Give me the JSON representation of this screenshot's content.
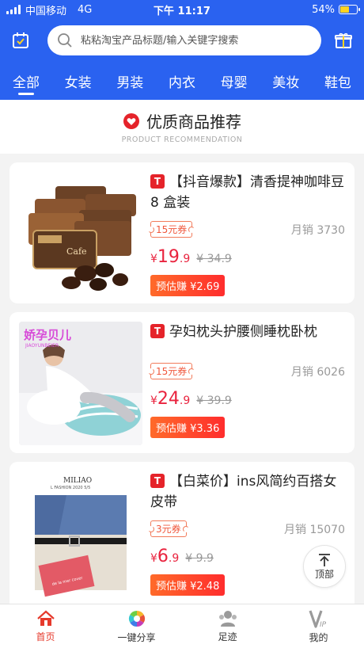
{
  "status_bar": {
    "carrier": "中国移动",
    "network": "4G",
    "time": "下午 11:17",
    "battery": "54%",
    "battery_fraction": 0.54
  },
  "search": {
    "placeholder": "粘粘淘宝产品标题/输入关键字搜索"
  },
  "icons": {
    "left": "calendar-check-icon",
    "search": "search-icon",
    "right": "gift-icon"
  },
  "tabs": [
    {
      "label": "全部",
      "active": true
    },
    {
      "label": "女装"
    },
    {
      "label": "男装"
    },
    {
      "label": "内衣"
    },
    {
      "label": "母婴"
    },
    {
      "label": "美妆"
    },
    {
      "label": "鞋包"
    }
  ],
  "recommend": {
    "title": "优质商品推荐",
    "subtitle": "PRODUCT RECOMMENDATION"
  },
  "products": [
    {
      "badge": "T",
      "title": "【抖音爆款】清香提神咖啡豆 8 盒装",
      "coupon": "15元券",
      "sales": "月销 3730",
      "price_currency": "¥",
      "price_int": "19",
      "price_dec": ".9",
      "original_price": "¥ 34.9",
      "earn": "预估赚 ¥2.69"
    },
    {
      "badge": "T",
      "title": "孕妇枕头护腰侧睡枕卧枕",
      "coupon": "15元券",
      "sales": "月销 6026",
      "price_currency": "¥",
      "price_int": "24",
      "price_dec": ".9",
      "original_price": "¥ 39.9",
      "earn": "预估赚 ¥3.36",
      "image_text": "娇孕贝儿",
      "image_subtext": "JIAOYUNBEIER"
    },
    {
      "badge": "T",
      "title": "【白菜价】ins风简约百搭女皮带",
      "coupon": "3元券",
      "sales": "月销 15070",
      "price_currency": "¥",
      "price_int": "6",
      "price_dec": ".9",
      "original_price": "¥ 9.9",
      "earn": "预估赚 ¥2.48",
      "image_text": "MILIAO",
      "image_subtext": "L FASHION 2020 5/5"
    }
  ],
  "top_button": {
    "label": "顶部"
  },
  "bottom_nav": [
    {
      "label": "首页",
      "icon": "home-icon",
      "active": true
    },
    {
      "label": "一键分享",
      "icon": "share-icon"
    },
    {
      "label": "足迹",
      "icon": "footprint-icon"
    },
    {
      "label": "我的",
      "icon": "vip-icon"
    }
  ],
  "colors": {
    "brand_blue": "#2a62f0",
    "price_red": "#e9233e",
    "accent_orange": "#ff6a2a"
  }
}
